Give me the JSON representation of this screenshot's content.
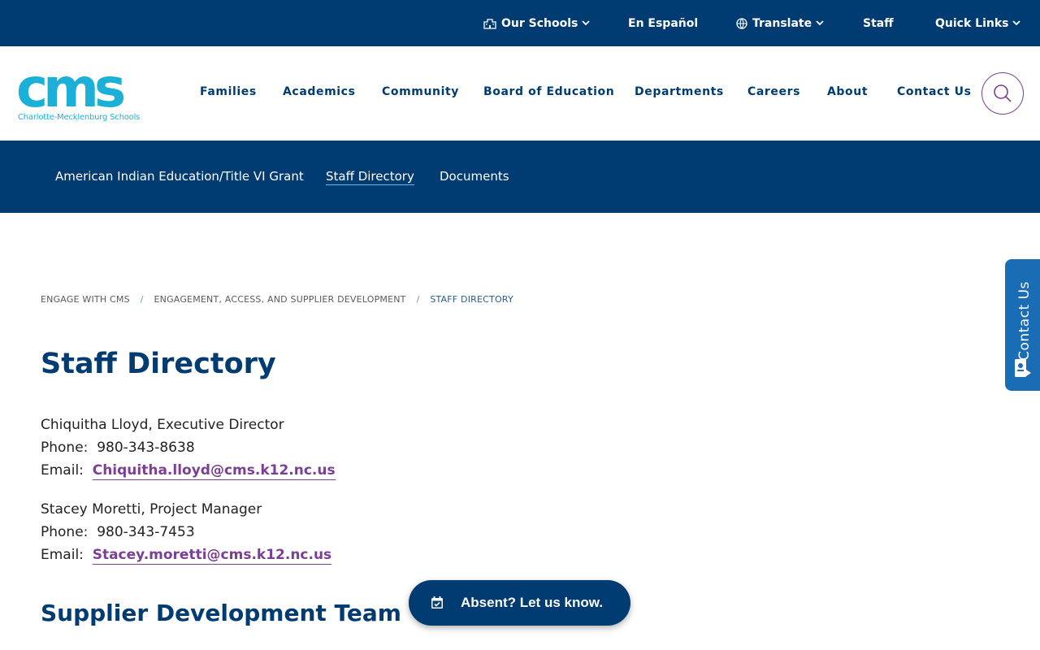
{
  "topbar": {
    "our_schools": "Our Schools",
    "espanol": "En Español",
    "translate": "Translate",
    "staff": "Staff",
    "quick_links": "Quick Links"
  },
  "logo": {
    "word": "cms",
    "subtitle": "Charlotte-Mecklenburg Schools"
  },
  "main_nav": {
    "families": "Families",
    "academics": "Academics",
    "community": "Community",
    "board": "Board of Education",
    "departments": "Departments",
    "careers": "Careers",
    "about": "About",
    "contact": "Contact Us"
  },
  "sub_nav": {
    "items": [
      "American Indian Education/Title VI Grant",
      "Staff Directory",
      "Documents"
    ],
    "active_index": 1
  },
  "breadcrumb": {
    "items": [
      "ENGAGE WITH CMS",
      "ENGAGEMENT, ACCESS, AND SUPPLIER DEVELOPMENT",
      "STAFF DIRECTORY"
    ],
    "separator": "/"
  },
  "page_title": "Staff Directory",
  "contacts": [
    {
      "name_title": "Chiquitha Lloyd, Executive Director",
      "phone_label": "Phone:",
      "phone": "980-343-8638",
      "email_label": "Email:",
      "email": "Chiquitha.lloyd@cms.k12.nc.us"
    },
    {
      "name_title": "Stacey Moretti, Project Manager",
      "phone_label": "Phone:",
      "phone": "980-343-7453",
      "email_label": "Email:",
      "email": "Stacey.moretti@cms.k12.nc.us"
    }
  ],
  "section_heading": "Supplier Development Team",
  "side_tab": {
    "label": "Contact Us"
  },
  "absent_button": {
    "label": "Absent? Let us know."
  },
  "colors": {
    "navy": "#003b71",
    "logo_cyan": "#1ab0d8",
    "link_purple": "#7b3f96",
    "side_tab_blue": "#1a6cb5"
  }
}
